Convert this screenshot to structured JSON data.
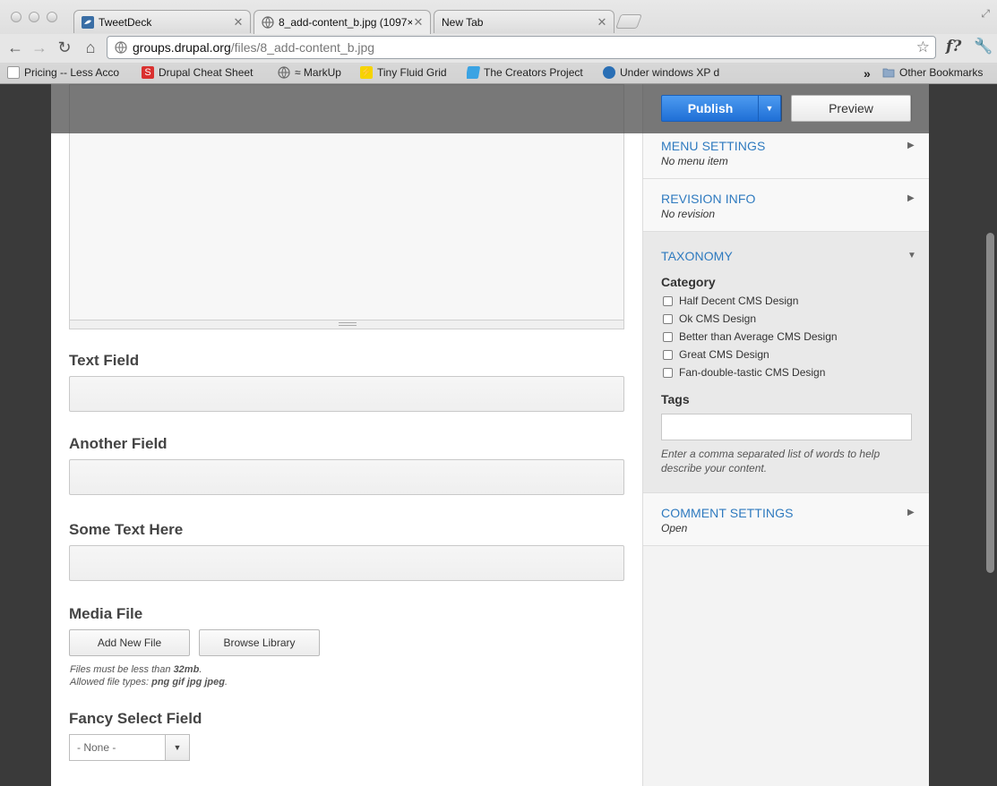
{
  "browser": {
    "tabs": [
      {
        "title": "TweetDeck",
        "active": false
      },
      {
        "title": "8_add-content_b.jpg (1097×",
        "active": true
      },
      {
        "title": "New Tab",
        "active": false
      }
    ],
    "url_host": "groups.drupal.org",
    "url_path": "/files/8_add-content_b.jpg",
    "bookmarks": [
      "Pricing -- Less Acco",
      "Drupal Cheat Sheet",
      "≈ MarkUp",
      "Tiny Fluid Grid",
      "The Creators Project",
      "Under windows XP d",
      "Other Bookmarks"
    ],
    "overflow_chevron": "»"
  },
  "form": {
    "text_field_label": "Text Field",
    "another_field_label": "Another Field",
    "some_text_label": "Some Text Here",
    "media_file_label": "Media File",
    "add_new_file": "Add New File",
    "browse_library": "Browse Library",
    "files_hint_prefix": "Files must be less than ",
    "files_hint_size": "32mb",
    "files_hint_suffix": ".",
    "types_hint_prefix": "Allowed file types: ",
    "types_hint_types": "png gif jpg jpeg",
    "types_hint_suffix": ".",
    "fancy_select_label": "Fancy Select Field",
    "fancy_select_value": "- None -"
  },
  "sidebar": {
    "publish": "Publish",
    "preview": "Preview",
    "menu_settings": {
      "title": "MENU SETTINGS",
      "sub": "No menu item"
    },
    "revision_info": {
      "title": "REVISION INFO",
      "sub": "No revision"
    },
    "taxonomy": {
      "title": "TAXONOMY",
      "category_label": "Category",
      "categories": [
        "Half Decent CMS Design",
        "Ok CMS Design",
        "Better than Average CMS Design",
        "Great CMS Design",
        "Fan-double-tastic CMS Design"
      ],
      "tags_label": "Tags",
      "tags_help": "Enter a comma separated list of words to help describe your content."
    },
    "comment_settings": {
      "title": "COMMENT SETTINGS",
      "sub": "Open"
    }
  },
  "colors": {
    "accent_link": "#2e7abf",
    "publish_blue": "#1f6fd6"
  }
}
